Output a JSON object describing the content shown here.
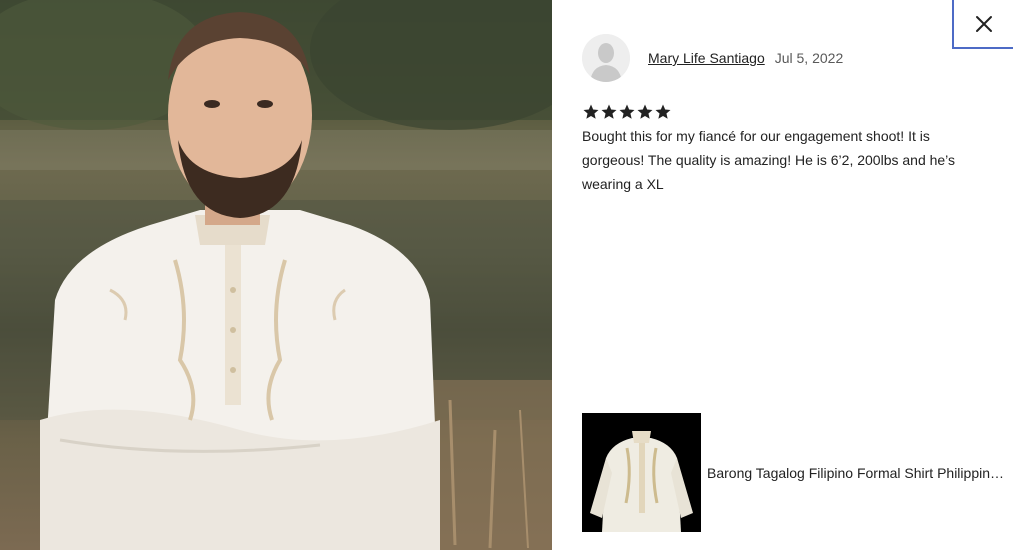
{
  "review": {
    "reviewer_name": "Mary Life Santiago",
    "date": "Jul 5, 2022",
    "rating": 5,
    "rating_max": 5,
    "text": "Bought this for my fiancé for our engagement shoot! It is gorgeous! The quality is amazing! He is 6’2, 200lbs and he’s wearing a XL"
  },
  "listing": {
    "title": "Barong Tagalog Filipino Formal Shirt Philippine Wedding Barong Tagalog"
  },
  "icons": {
    "close": "close-icon",
    "avatar": "default-user-avatar",
    "star": "star-icon"
  },
  "colors": {
    "focus_outline": "#4d6bc6",
    "star": "#222222",
    "text": "#222222",
    "date": "#595959"
  }
}
